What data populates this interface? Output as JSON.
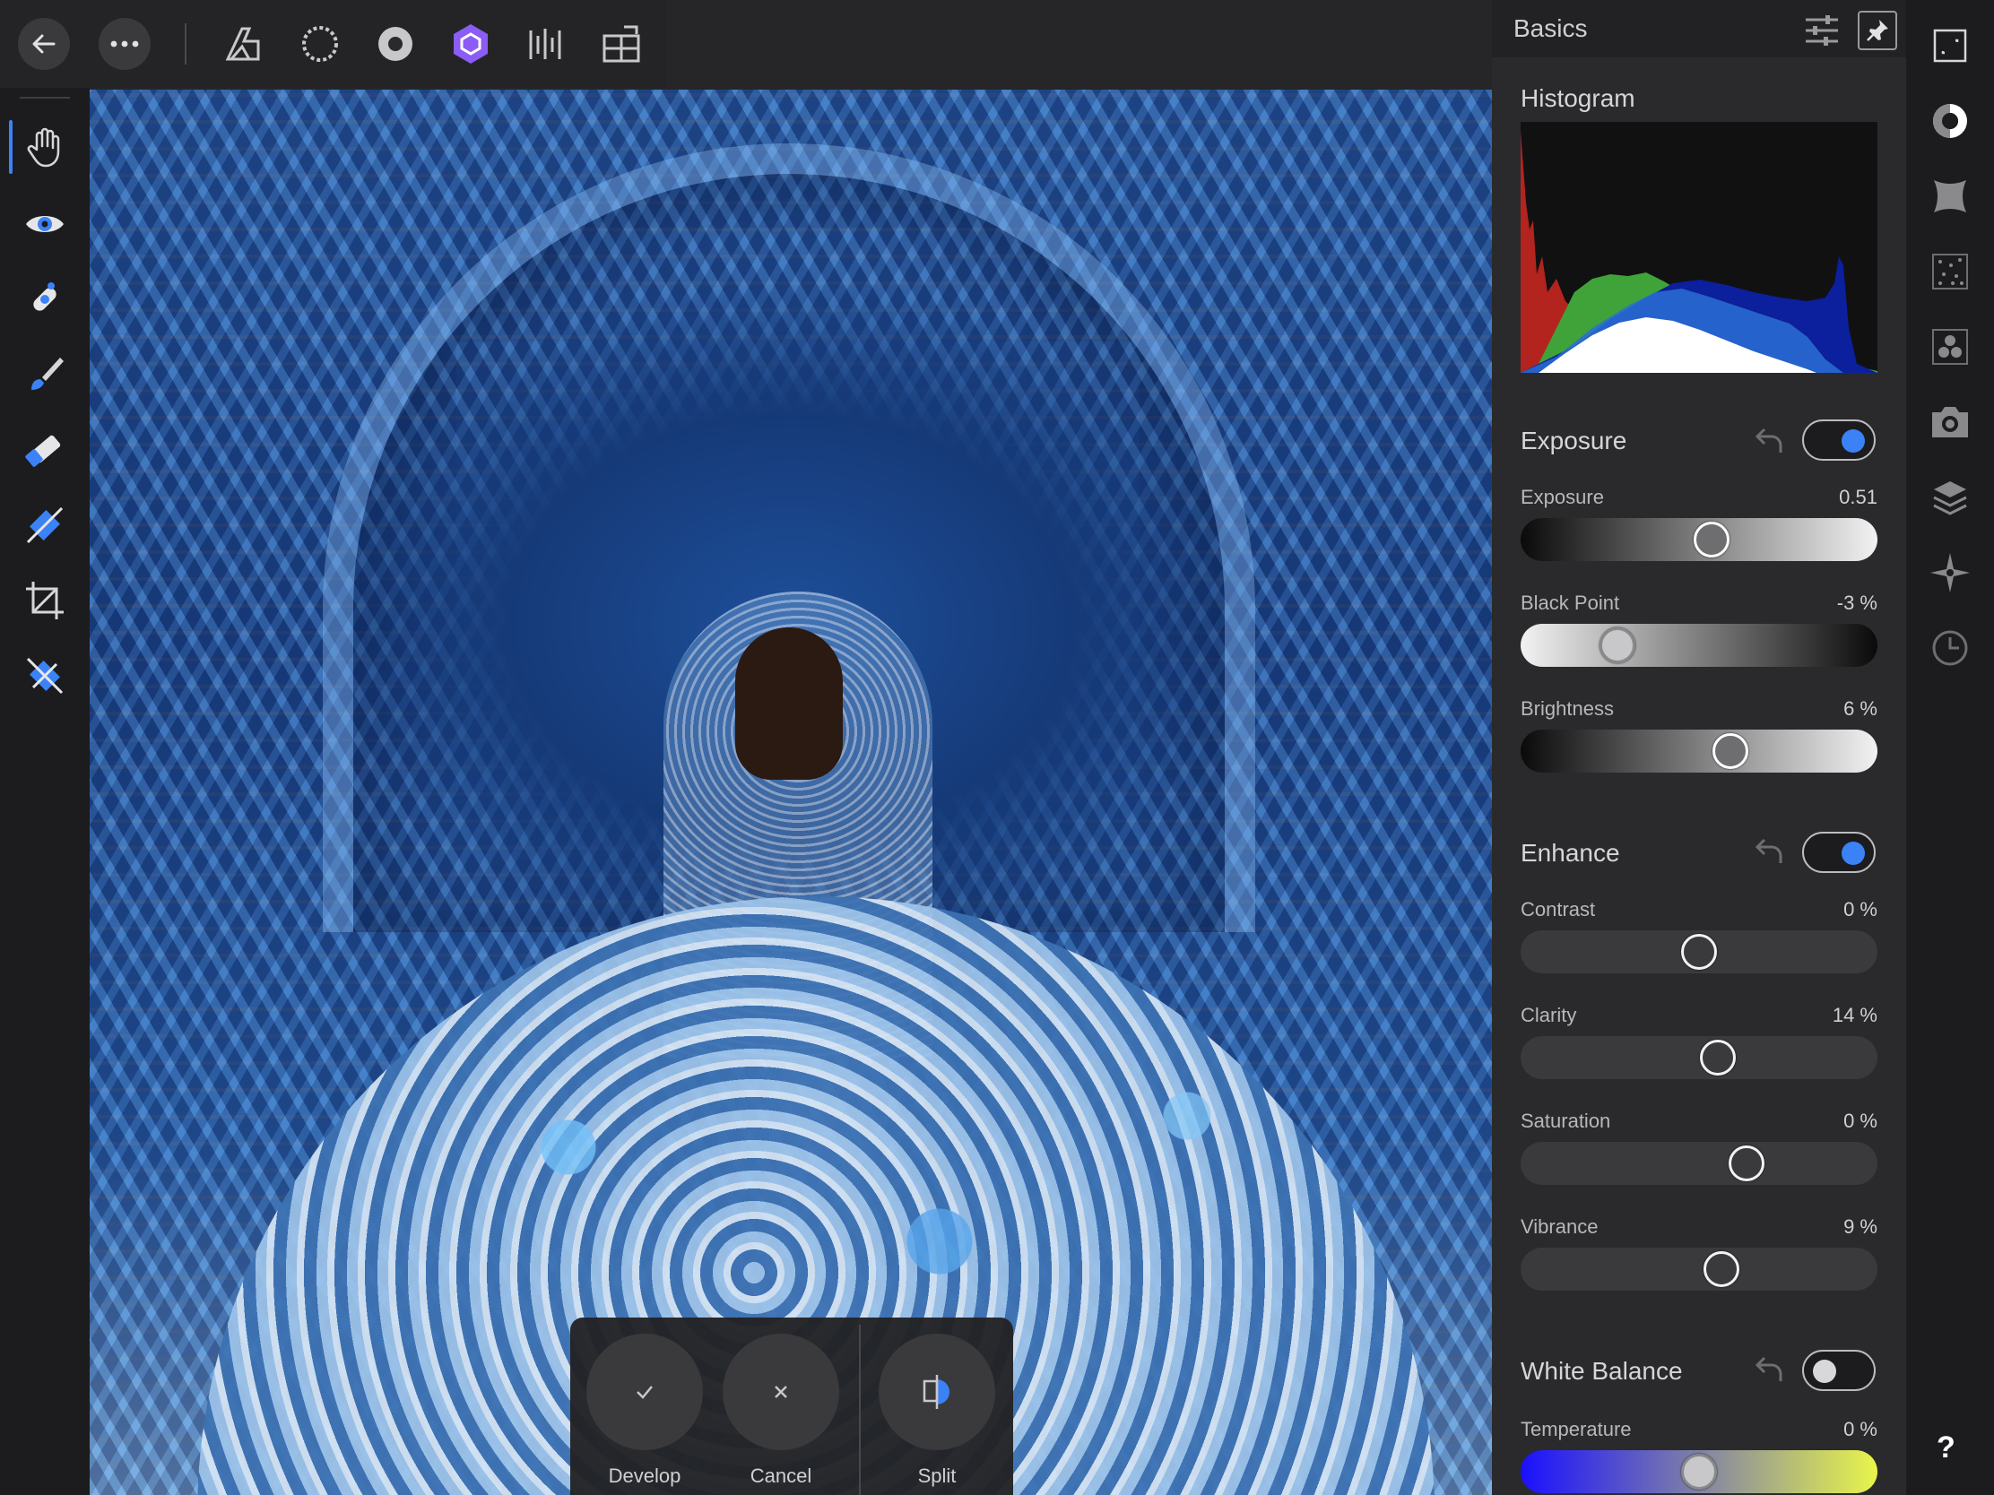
{
  "panel": {
    "title": "Basics",
    "histogram_label": "Histogram"
  },
  "exposure": {
    "title": "Exposure",
    "enabled": true,
    "sliders": [
      {
        "label": "Exposure",
        "value": "0.51",
        "position": 0.54
      },
      {
        "label": "Black Point",
        "value": "-3 %",
        "position": 0.24
      },
      {
        "label": "Brightness",
        "value": "6 %",
        "position": 0.6
      }
    ]
  },
  "enhance": {
    "title": "Enhance",
    "enabled": true,
    "sliders": [
      {
        "label": "Contrast",
        "value": "0 %",
        "position": 0.5
      },
      {
        "label": "Clarity",
        "value": "14 %",
        "position": 0.56
      },
      {
        "label": "Saturation",
        "value": "0 %",
        "position": 0.65
      },
      {
        "label": "Vibrance",
        "value": "9 %",
        "position": 0.57
      }
    ]
  },
  "white_balance": {
    "title": "White Balance",
    "enabled": false,
    "sliders": [
      {
        "label": "Temperature",
        "value": "0 %",
        "position": 0.5
      }
    ]
  },
  "actions": {
    "develop": "Develop",
    "cancel": "Cancel",
    "split": "Split"
  },
  "icons": {
    "topbar": [
      "back-icon",
      "more-icon",
      "photo-persona-icon",
      "liquify-persona-icon",
      "develop-persona-icon",
      "tone-mapping-persona-icon",
      "export-persona-icon",
      "share-icon"
    ],
    "lefttools": [
      "hand-tool-icon",
      "red-eye-icon",
      "blemish-icon",
      "brush-icon",
      "eraser-icon",
      "gradient-icon",
      "crop-icon",
      "overlay-icon"
    ],
    "strip": [
      "fullscreen-icon",
      "basics-icon",
      "lens-icon",
      "details-icon",
      "tones-icon",
      "profiles-icon",
      "overlays-icon",
      "focus-icon",
      "history-icon",
      "help-icon"
    ]
  },
  "help_label": "?",
  "colors": {
    "accent": "#3b82f6",
    "active_persona": "#8b5cf6"
  }
}
